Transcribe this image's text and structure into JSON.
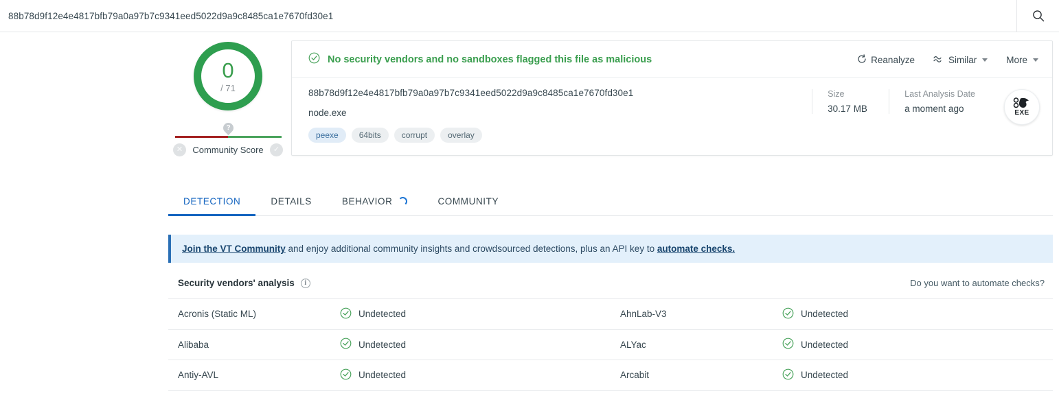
{
  "topbar": {
    "hash": "88b78d9f12e4e4817bfb79a0a97b7c9341eed5022d9a9c8485ca1e7670fd30e1",
    "search_icon": "search-icon"
  },
  "score": {
    "detections": "0",
    "total": "/ 71",
    "ring_color": "#2e9e4f",
    "community_score_label": "Community Score",
    "bar_left_color": "#a42121",
    "bar_right_color": "#4aa35c",
    "negative_icon": "✕",
    "positive_icon": "✓",
    "pin_icon": "?"
  },
  "verdict": {
    "text": "No security vendors and no sandboxes flagged this file as malicious",
    "color": "#3a9e4e",
    "icon": "check-circle-icon"
  },
  "actions": {
    "reanalyze": "Reanalyze",
    "similar": "Similar",
    "more": "More"
  },
  "file": {
    "hash": "88b78d9f12e4e4817bfb79a0a97b7c9341eed5022d9a9c8485ca1e7670fd30e1",
    "name": "node.exe",
    "tags": [
      {
        "label": "peexe",
        "style": "blue"
      },
      {
        "label": "64bits",
        "style": "gray"
      },
      {
        "label": "corrupt",
        "style": "gray"
      },
      {
        "label": "overlay",
        "style": "gray"
      }
    ],
    "size_label": "Size",
    "size_value": "30.17 MB",
    "last_analysis_label": "Last Analysis Date",
    "last_analysis_value": "a moment ago",
    "filetype_label": "EXE"
  },
  "tabs": [
    {
      "label": "DETECTION",
      "active": true,
      "spinner": false
    },
    {
      "label": "DETAILS",
      "active": false,
      "spinner": false
    },
    {
      "label": "BEHAVIOR",
      "active": false,
      "spinner": true
    },
    {
      "label": "COMMUNITY",
      "active": false,
      "spinner": false
    }
  ],
  "banner": {
    "link1": "Join the VT Community",
    "middle": " and enjoy additional community insights and crowdsourced detections, plus an API key to ",
    "link2": "automate checks."
  },
  "vendors": {
    "title": "Security vendors' analysis",
    "automate_question": "Do you want to automate checks?",
    "rows": [
      {
        "left_name": "Acronis (Static ML)",
        "left_result": "Undetected",
        "right_name": "AhnLab-V3",
        "right_result": "Undetected"
      },
      {
        "left_name": "Alibaba",
        "left_result": "Undetected",
        "right_name": "ALYac",
        "right_result": "Undetected"
      },
      {
        "left_name": "Antiy-AVL",
        "left_result": "Undetected",
        "right_name": "Arcabit",
        "right_result": "Undetected"
      }
    ]
  }
}
